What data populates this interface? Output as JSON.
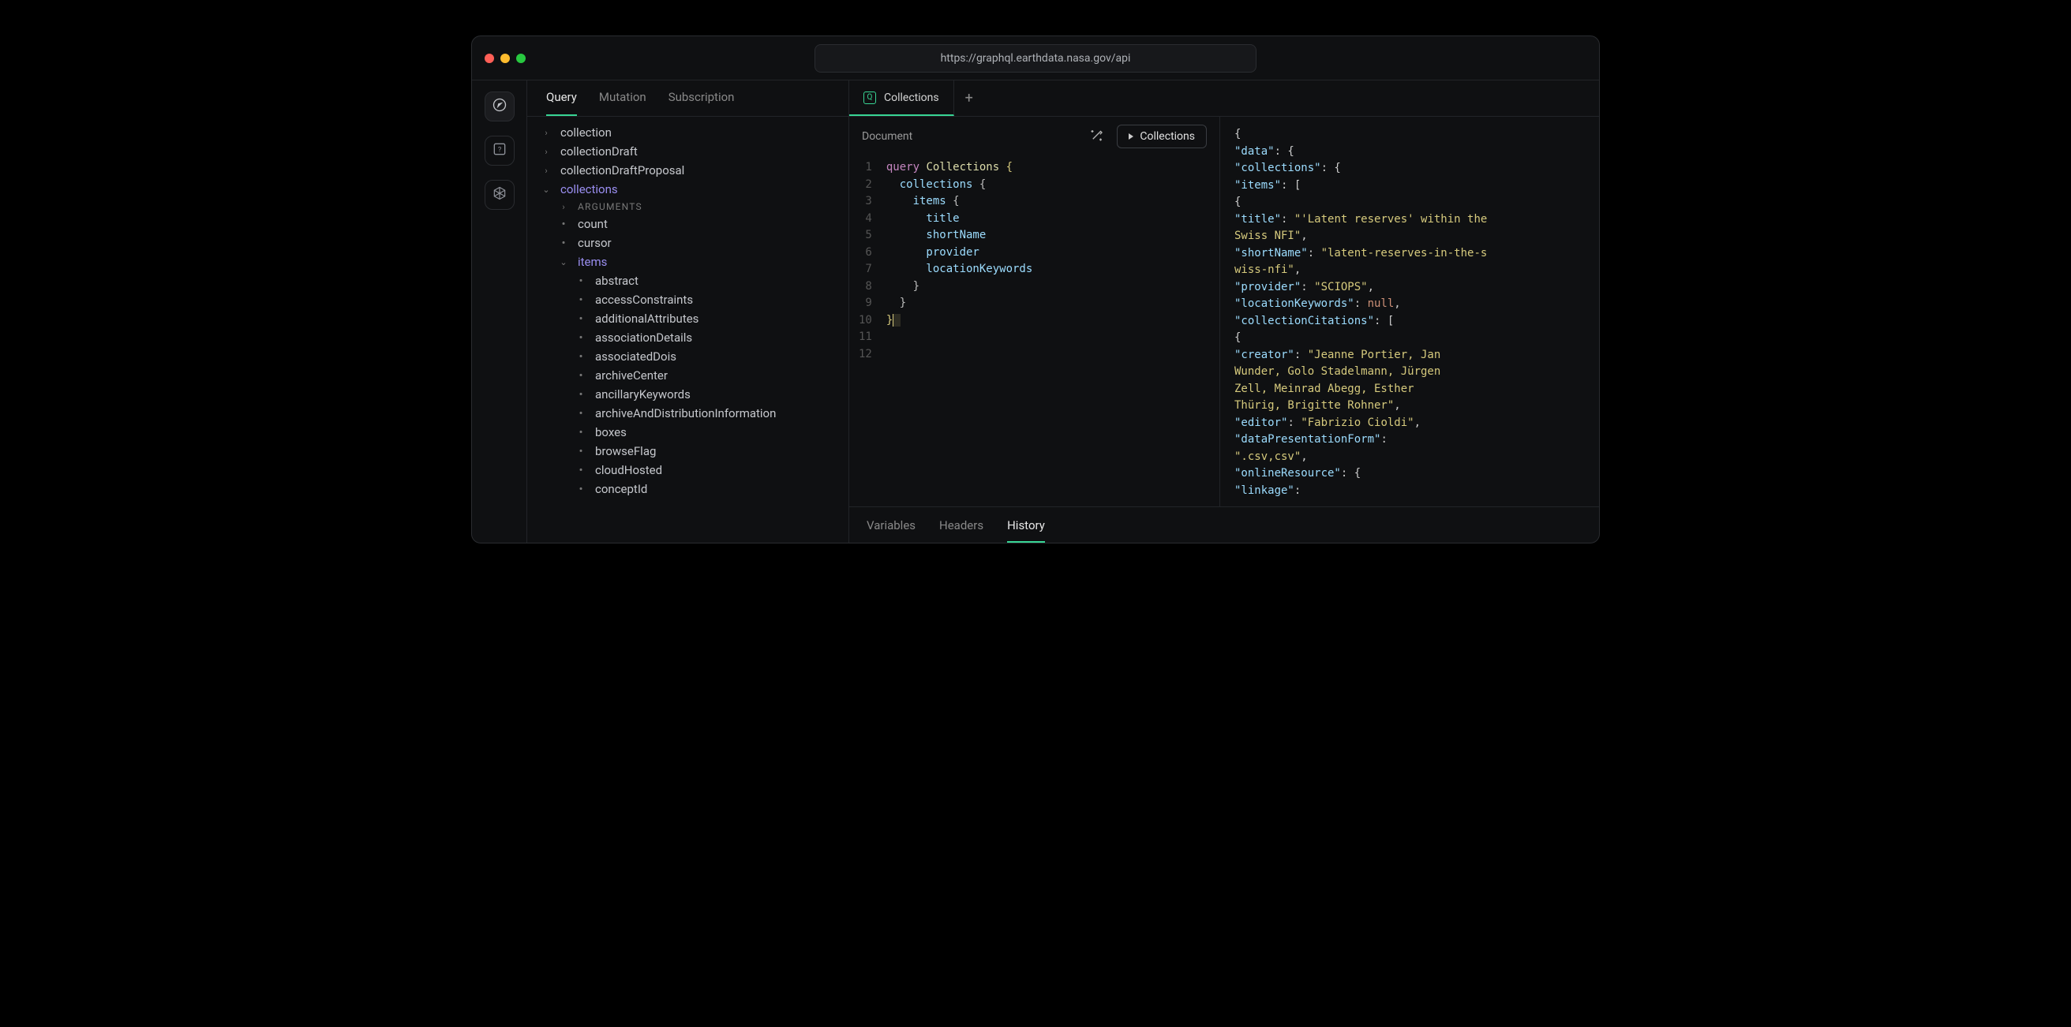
{
  "url": "https://graphql.earthdata.nasa.gov/api",
  "operation_tabs": [
    "Query",
    "Mutation",
    "Subscription"
  ],
  "operation_active": "Query",
  "tree": {
    "items": [
      {
        "label": "collection",
        "level": 0,
        "icon": "caret-right",
        "hilite": false
      },
      {
        "label": "collectionDraft",
        "level": 0,
        "icon": "caret-right",
        "hilite": false
      },
      {
        "label": "collectionDraftProposal",
        "level": 0,
        "icon": "caret-right",
        "hilite": false
      },
      {
        "label": "collections",
        "level": 0,
        "icon": "caret-down",
        "hilite": true
      },
      {
        "label": "ARGUMENTS",
        "level": 1,
        "icon": "caret-right",
        "args": true
      },
      {
        "label": "count",
        "level": 1,
        "icon": "dot"
      },
      {
        "label": "cursor",
        "level": 1,
        "icon": "dot"
      },
      {
        "label": "items",
        "level": 1,
        "icon": "caret-down",
        "hilite": true
      },
      {
        "label": "abstract",
        "level": 2,
        "icon": "dot"
      },
      {
        "label": "accessConstraints",
        "level": 2,
        "icon": "dot"
      },
      {
        "label": "additionalAttributes",
        "level": 2,
        "icon": "dot"
      },
      {
        "label": "associationDetails",
        "level": 2,
        "icon": "dot"
      },
      {
        "label": "associatedDois",
        "level": 2,
        "icon": "dot"
      },
      {
        "label": "archiveCenter",
        "level": 2,
        "icon": "dot"
      },
      {
        "label": "ancillaryKeywords",
        "level": 2,
        "icon": "dot"
      },
      {
        "label": "archiveAndDistributionInformation",
        "level": 2,
        "icon": "dot"
      },
      {
        "label": "boxes",
        "level": 2,
        "icon": "dot"
      },
      {
        "label": "browseFlag",
        "level": 2,
        "icon": "dot"
      },
      {
        "label": "cloudHosted",
        "level": 2,
        "icon": "dot"
      },
      {
        "label": "conceptId",
        "level": 2,
        "icon": "dot"
      }
    ]
  },
  "doc_tab": {
    "badge": "Q",
    "name": "Collections"
  },
  "editor": {
    "label": "Document",
    "run_button": "Collections",
    "line_count": 12,
    "lines": [
      {
        "n": 1,
        "tokens": [
          [
            "kw",
            "query "
          ],
          [
            "fn",
            "Collections"
          ],
          [
            "punc",
            " "
          ],
          [
            "punc-ylw",
            "{"
          ]
        ]
      },
      {
        "n": 2,
        "tokens": [
          [
            "fld",
            "  collections "
          ],
          [
            "punc",
            "{"
          ]
        ]
      },
      {
        "n": 3,
        "tokens": [
          [
            "fld",
            "    items "
          ],
          [
            "punc",
            "{"
          ]
        ]
      },
      {
        "n": 4,
        "tokens": [
          [
            "fld",
            "      title"
          ]
        ]
      },
      {
        "n": 5,
        "tokens": [
          [
            "fld",
            "      shortName"
          ]
        ]
      },
      {
        "n": 6,
        "tokens": [
          [
            "fld",
            "      provider"
          ]
        ]
      },
      {
        "n": 7,
        "tokens": [
          [
            "fld",
            "      locationKeywords"
          ]
        ]
      },
      {
        "n": 8,
        "tokens": [
          [
            "punc",
            "    }"
          ]
        ]
      },
      {
        "n": 9,
        "tokens": [
          [
            "punc",
            "  }"
          ]
        ]
      },
      {
        "n": 10,
        "tokens": [
          [
            "punc-ylw",
            "}"
          ]
        ],
        "cursor": true
      },
      {
        "n": 11,
        "tokens": []
      },
      {
        "n": 12,
        "tokens": []
      }
    ]
  },
  "result": {
    "lines": [
      [
        [
          "jpunc",
          "{"
        ]
      ],
      [
        [
          "jpunc",
          "  "
        ],
        [
          "jkey",
          "\"data\""
        ],
        [
          "jpunc",
          ": {"
        ]
      ],
      [
        [
          "jpunc",
          "    "
        ],
        [
          "jkey",
          "\"collections\""
        ],
        [
          "jpunc",
          ": {"
        ]
      ],
      [
        [
          "jpunc",
          "      "
        ],
        [
          "jkey",
          "\"items\""
        ],
        [
          "jpunc",
          ": ["
        ]
      ],
      [
        [
          "jpunc",
          "        {"
        ]
      ],
      [
        [
          "jpunc",
          "          "
        ],
        [
          "jkey",
          "\"title\""
        ],
        [
          "jpunc",
          ": "
        ],
        [
          "jstr",
          "\"'Latent reserves' within the"
        ]
      ],
      [
        [
          "jstr",
          "Swiss NFI\""
        ],
        [
          "jpunc",
          ","
        ]
      ],
      [
        [
          "jpunc",
          "          "
        ],
        [
          "jkey",
          "\"shortName\""
        ],
        [
          "jpunc",
          ": "
        ],
        [
          "jstr",
          "\"latent-reserves-in-the-s"
        ]
      ],
      [
        [
          "jstr",
          "wiss-nfi\""
        ],
        [
          "jpunc",
          ","
        ]
      ],
      [
        [
          "jpunc",
          "          "
        ],
        [
          "jkey",
          "\"provider\""
        ],
        [
          "jpunc",
          ": "
        ],
        [
          "jstr",
          "\"SCIOPS\""
        ],
        [
          "jpunc",
          ","
        ]
      ],
      [
        [
          "jpunc",
          "          "
        ],
        [
          "jkey",
          "\"locationKeywords\""
        ],
        [
          "jpunc",
          ": "
        ],
        [
          "jnull",
          "null"
        ],
        [
          "jpunc",
          ","
        ]
      ],
      [
        [
          "jpunc",
          "          "
        ],
        [
          "jkey",
          "\"collectionCitations\""
        ],
        [
          "jpunc",
          ": ["
        ]
      ],
      [
        [
          "jpunc",
          "            {"
        ]
      ],
      [
        [
          "jpunc",
          "              "
        ],
        [
          "jkey",
          "\"creator\""
        ],
        [
          "jpunc",
          ": "
        ],
        [
          "jstr",
          "\"Jeanne Portier, Jan"
        ]
      ],
      [
        [
          "jstr",
          "Wunder, Golo Stadelmann, Jürgen"
        ]
      ],
      [
        [
          "jstr",
          "Zell, Meinrad Abegg, Esther"
        ]
      ],
      [
        [
          "jstr",
          "Thürig, Brigitte Rohner\""
        ],
        [
          "jpunc",
          ","
        ]
      ],
      [
        [
          "jpunc",
          "              "
        ],
        [
          "jkey",
          "\"editor\""
        ],
        [
          "jpunc",
          ": "
        ],
        [
          "jstr",
          "\"Fabrizio Cioldi\""
        ],
        [
          "jpunc",
          ","
        ]
      ],
      [
        [
          "jpunc",
          "              "
        ],
        [
          "jkey",
          "\"dataPresentationForm\""
        ],
        [
          "jpunc",
          ":"
        ]
      ],
      [
        [
          "jstr",
          "\".csv,csv\""
        ],
        [
          "jpunc",
          ","
        ]
      ],
      [
        [
          "jpunc",
          "              "
        ],
        [
          "jkey",
          "\"onlineResource\""
        ],
        [
          "jpunc",
          ": {"
        ]
      ],
      [
        [
          "jpunc",
          "                "
        ],
        [
          "jkey",
          "\"linkage\""
        ],
        [
          "jpunc",
          ":"
        ]
      ]
    ]
  },
  "bottom_tabs": [
    "Variables",
    "Headers",
    "History"
  ],
  "bottom_active": "History"
}
